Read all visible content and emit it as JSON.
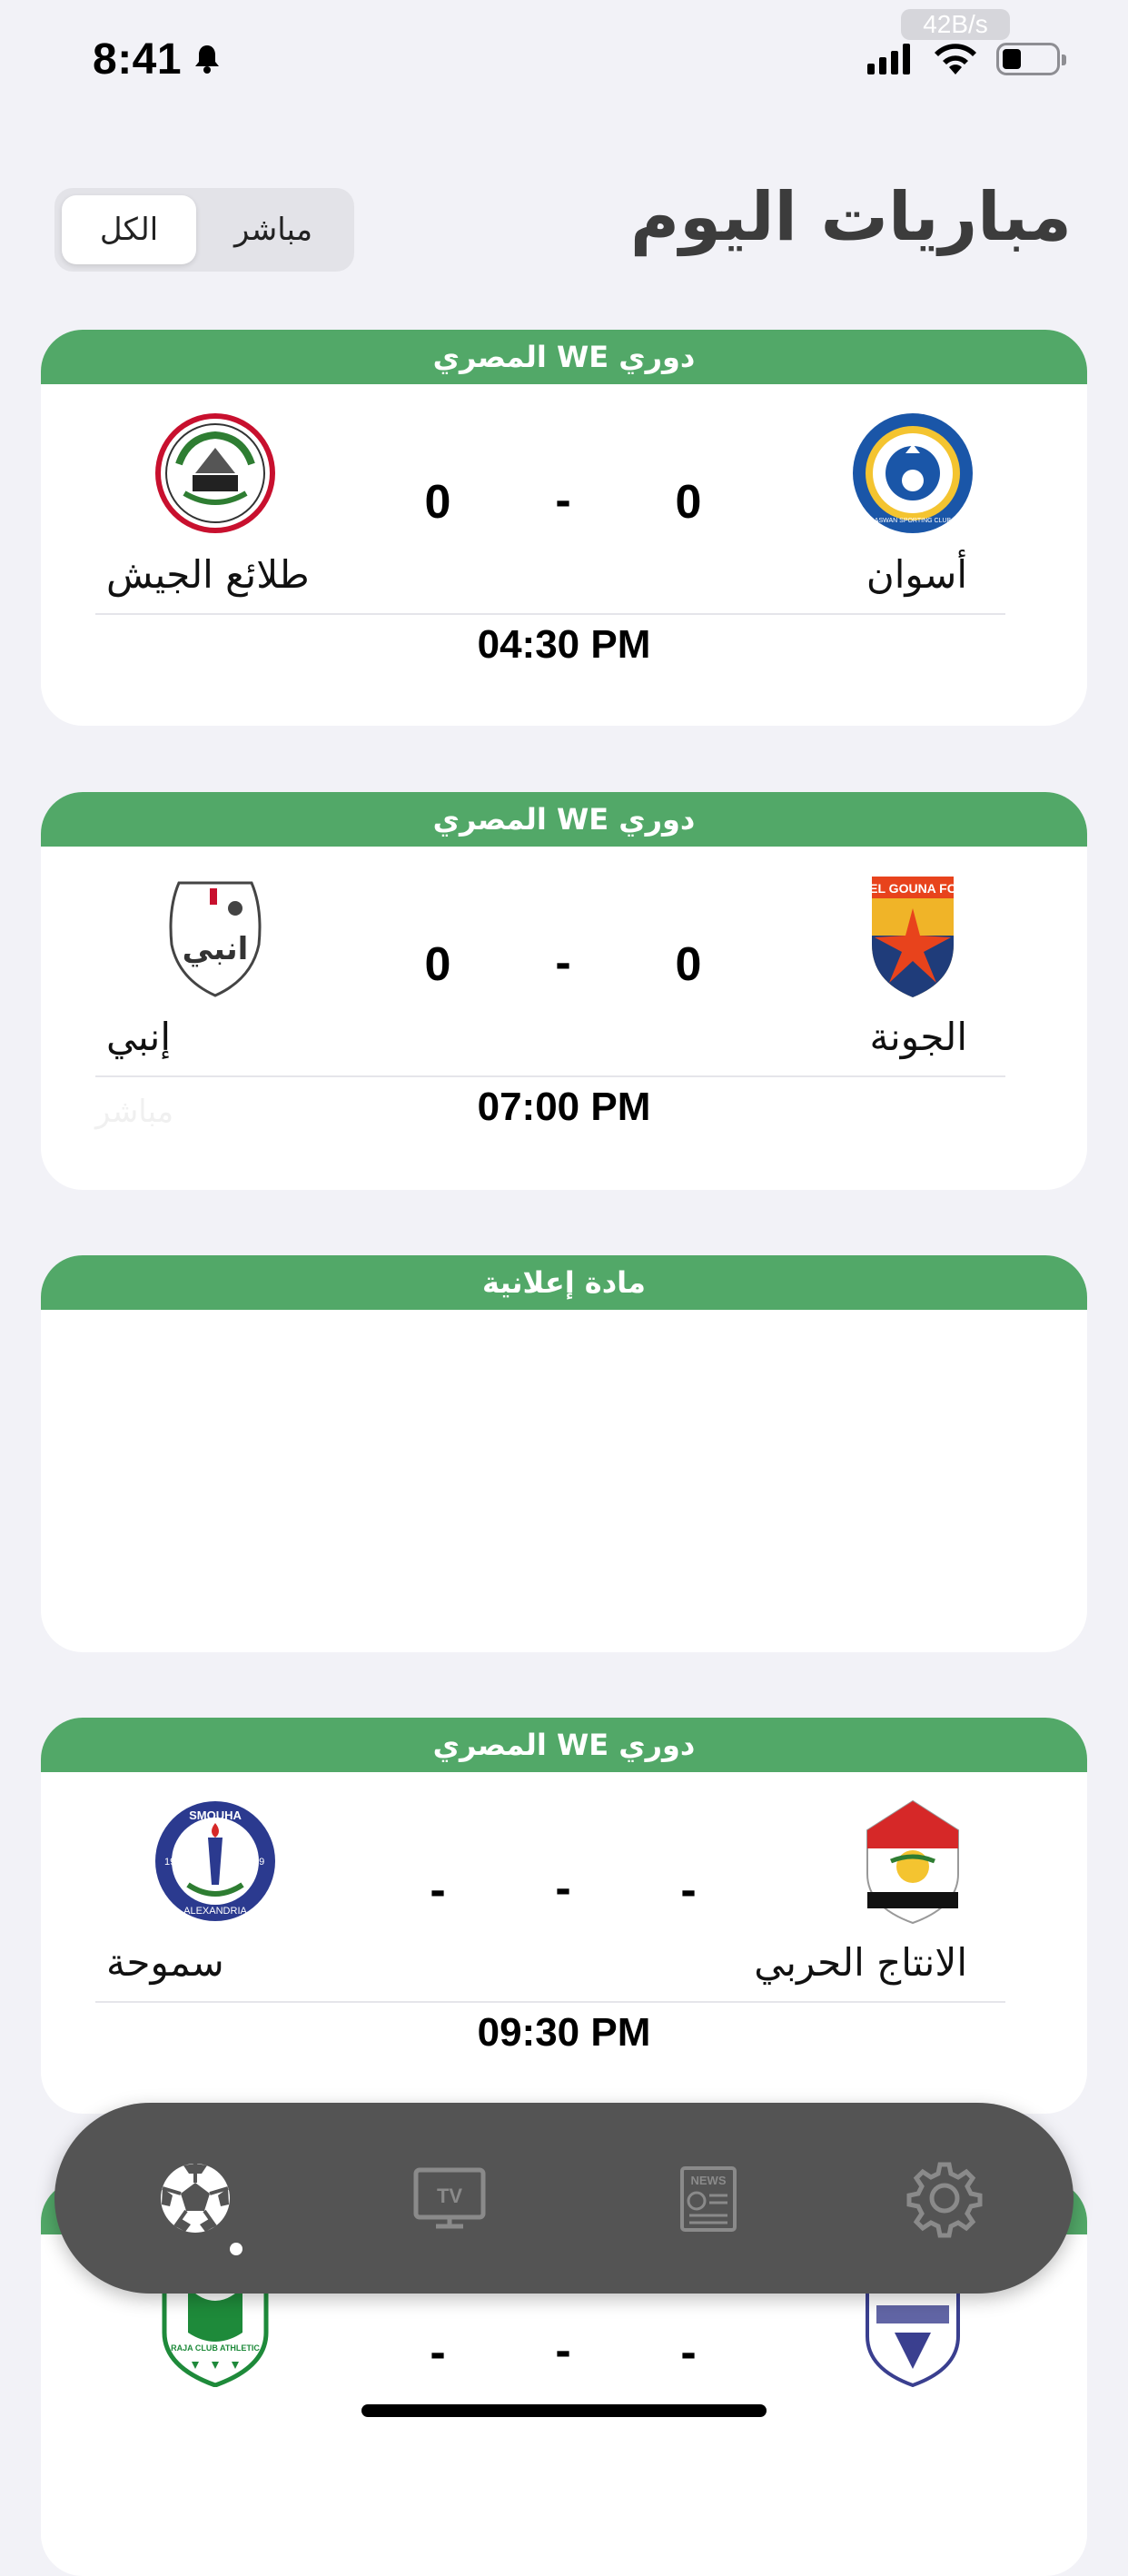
{
  "status": {
    "time": "8:41",
    "speed": "42B/s"
  },
  "header": {
    "title": "مباريات اليوم",
    "segments": [
      {
        "label": "الكل",
        "selected": true
      },
      {
        "label": "مباشر",
        "selected": false
      }
    ]
  },
  "matches": [
    {
      "league": "دوري WE المصري",
      "home_team": "أسوان",
      "away_team": "طلائع الجيش",
      "home_score": "0",
      "away_score": "0",
      "separator": "-",
      "kickoff": "04:30 PM",
      "live_label": ""
    },
    {
      "league": "دوري WE المصري",
      "home_team": "الجونة",
      "away_team": "إنبي",
      "home_score": "0",
      "away_score": "0",
      "separator": "-",
      "kickoff": "07:00 PM",
      "live_label": "مباشر"
    },
    {
      "league": "دوري WE المصري",
      "home_team": "الانتاج الحربي",
      "away_team": "سموحة",
      "home_score": "-",
      "away_score": "-",
      "separator": "-",
      "kickoff": "09:30 PM",
      "live_label": ""
    },
    {
      "league": "",
      "home_team": "",
      "away_team": "",
      "home_score": "-",
      "away_score": "-",
      "separator": "-",
      "kickoff": "",
      "live_label": ""
    }
  ],
  "ad": {
    "label": "مادة إعلانية"
  },
  "logos": {
    "gouna_text": "EL GOUNA FC",
    "aswan_text": "ASWAN SPORTING CLUB",
    "smouha_top": "SMOUHA",
    "smouha_bottom": "ALEXANDRIA",
    "smouha_year_left": "19",
    "smouha_year_right": "49",
    "enppi_text": "انبي",
    "raja_text": "RAJA CLUB ATHLETIC"
  },
  "colors": {
    "league_green": "#52a868",
    "nav_bg": "#545454",
    "page_bg": "#f2f2f7"
  },
  "nav": {
    "items": [
      {
        "icon": "soccer-ball-icon",
        "active": true
      },
      {
        "icon": "tv-icon",
        "active": false
      },
      {
        "icon": "news-icon",
        "active": false
      },
      {
        "icon": "gear-icon",
        "active": false
      }
    ],
    "tv_label": "TV",
    "news_label": "NEWS"
  }
}
